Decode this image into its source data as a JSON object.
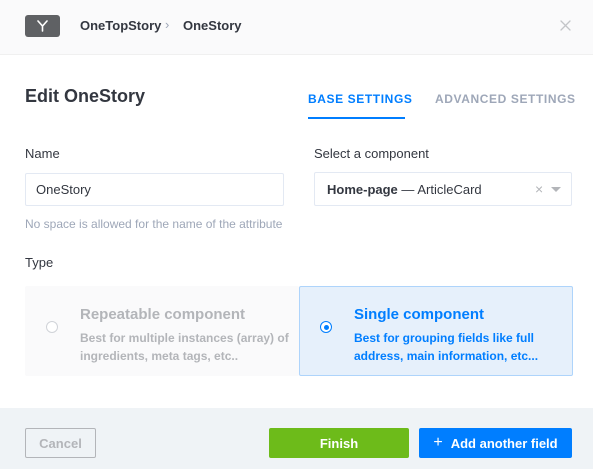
{
  "header": {
    "breadcrumb": [
      "OneTopStory",
      "OneStory"
    ],
    "breadcrumb_separator": "›"
  },
  "modal": {
    "title": "Edit OneStory",
    "tabs": [
      {
        "label": "BASE SETTINGS",
        "active": true
      },
      {
        "label": "ADVANCED SETTINGS",
        "active": false
      }
    ]
  },
  "form": {
    "name_label": "Name",
    "name_value": "OneStory",
    "name_hint": "No space is allowed for the name of the attribute",
    "component_label": "Select a component",
    "component_category": "Home-page",
    "component_separator": "—",
    "component_name": "ArticleCard",
    "clear_symbol": "×",
    "type_label": "Type",
    "type_options": [
      {
        "title": "Repeatable component",
        "description": "Best for multiple instances (array) of ingredients, meta tags, etc..",
        "selected": false
      },
      {
        "title": "Single component",
        "description": "Best for grouping fields like full address, main information, etc...",
        "selected": true
      }
    ]
  },
  "footer": {
    "cancel_label": "Cancel",
    "finish_label": "Finish",
    "add_label": "Add another field",
    "add_icon": "+"
  },
  "colors": {
    "accent": "#007eff",
    "success": "#6dbb1a",
    "muted": "#b3b5b9"
  },
  "icons": {
    "logo": "branch-icon",
    "close": "close-icon",
    "plus": "plus-icon"
  }
}
